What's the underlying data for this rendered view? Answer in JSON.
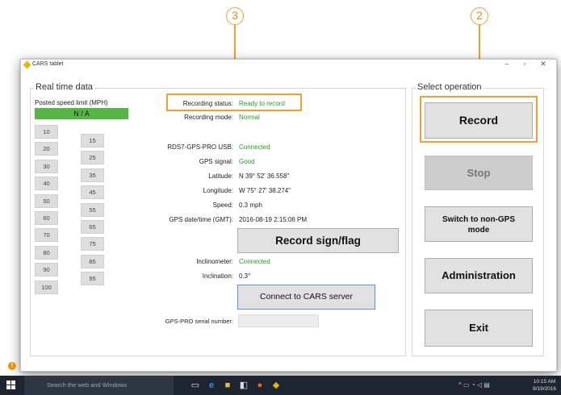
{
  "callouts": {
    "left": "3",
    "right": "2"
  },
  "window": {
    "title": "CARS tablet",
    "minimize": "–",
    "maximize": "▫",
    "close": "✕"
  },
  "realtime": {
    "group_title": "Real time data",
    "speed_limit_label": "Posted speed limit (MPH)",
    "speed_limit_value": "N / A",
    "speeds_left": [
      "10",
      "20",
      "30",
      "40",
      "50",
      "60",
      "70",
      "80",
      "90",
      "100"
    ],
    "speeds_right": [
      "15",
      "25",
      "35",
      "45",
      "55",
      "65",
      "75",
      "85",
      "95"
    ],
    "recording_status_label": "Recording status:",
    "recording_status_value": "Ready to record",
    "recording_mode_label": "Recording mode:",
    "recording_mode_value": "Normal",
    "usb_label": "RDS7-GPS-PRO USB:",
    "usb_value": "Connected",
    "gps_signal_label": "GPS signal:",
    "gps_signal_value": "Good",
    "latitude_label": "Latitude:",
    "latitude_value": "N 39° 52' 36.558\"",
    "longitude_label": "Longitude:",
    "longitude_value": "W 75° 27' 38.274\"",
    "speed_label": "Speed:",
    "speed_value": "0.3 mph",
    "gps_datetime_label": "GPS date/time (GMT):",
    "gps_datetime_value": "2016-08-19 2:15:06 PM",
    "record_sign_button": "Record sign/flag",
    "inclinometer_label": "Inclinometer:",
    "inclinometer_value": "Connected",
    "inclination_label": "Inclination:",
    "inclination_value": "0.3°",
    "connect_button": "Connect to CARS server",
    "serial_label": "GPS-PRO serial number:",
    "serial_value": ""
  },
  "operation": {
    "group_title": "Select operation",
    "record": "Record",
    "stop": "Stop",
    "switch_mode_line1": "Switch to non-GPS",
    "switch_mode_line2": "mode",
    "administration": "Administration",
    "exit": "Exit"
  },
  "taskbar": {
    "search_placeholder": "Search the web and Windows",
    "time": "10:15 AM",
    "date": "8/19/2016"
  },
  "colors": {
    "accent_orange": "#f0a030",
    "status_green": "#2a9a2a",
    "speed_green": "#55b545"
  }
}
